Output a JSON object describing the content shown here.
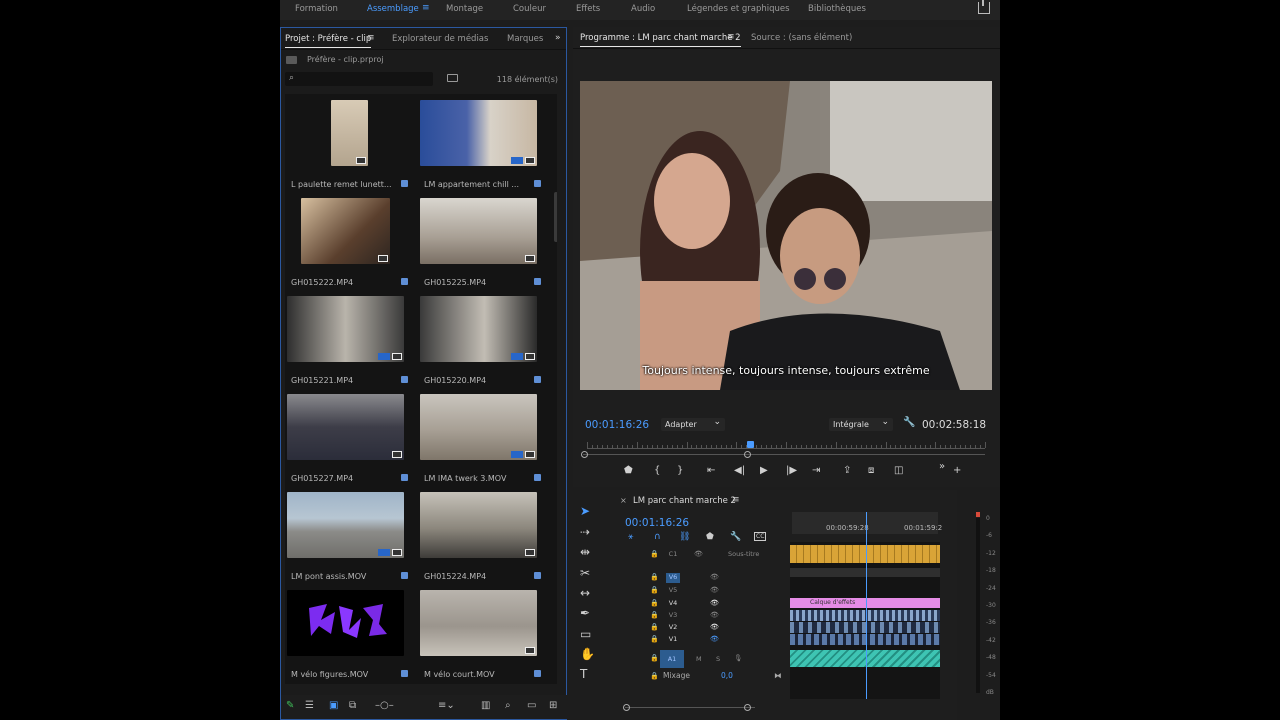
{
  "workspaces": [
    "Formation",
    "Assemblage",
    "Montage",
    "Couleur",
    "Effets",
    "Audio",
    "Légendes et graphiques",
    "Bibliothèques"
  ],
  "active_workspace": "Assemblage",
  "project_panel": {
    "tabs": [
      "Projet : Préfère - clip",
      "Explorateur de médias",
      "Marques"
    ],
    "path": "Préfère - clip.prproj",
    "item_count": "118 élément(s)",
    "items": [
      {
        "label": "L paulette remet lunett...",
        "color": "#cfc2b0"
      },
      {
        "label": "LM appartement chill ...",
        "color": "#8a7a6e"
      },
      {
        "label": "GH015222.MP4",
        "color": "#6a4e38"
      },
      {
        "label": "GH015225.MP4",
        "color": "#b7b0a6"
      },
      {
        "label": "GH015221.MP4",
        "color": "#5a5650"
      },
      {
        "label": "GH015220.MP4",
        "color": "#4e4a45"
      },
      {
        "label": "GH015227.MP4",
        "color": "#4a4a52"
      },
      {
        "label": "LM IMA twerk 3.MOV",
        "color": "#a49d93"
      },
      {
        "label": "LM pont assis.MOV",
        "color": "#8fa0b0"
      },
      {
        "label": "GH015224.MP4",
        "color": "#6f6a60"
      },
      {
        "label": "M vélo figures.MOV",
        "color": "#000000"
      },
      {
        "label": "M vélo court.MOV",
        "color": "#9f9a94"
      }
    ]
  },
  "program_monitor": {
    "tabs": [
      "Programme : LM parc chant marche 2",
      "Source : (sans élément)"
    ],
    "subtitle": "Toujours intense, toujours intense, toujours extrême",
    "current_tc": "00:01:16:26",
    "fit": "Adapter",
    "quality": "Intégrale",
    "duration_tc": "00:02:58:18",
    "playhead_fraction": 0.41
  },
  "timeline": {
    "tab": "LM parc chant marche 2",
    "current_tc": "00:01:16:26",
    "ruler_labels": [
      "00:00:59:28",
      "00:01:59:2"
    ],
    "subtitle_track": "Sous-titre",
    "effects_clip": "Calque d'effets",
    "video_tracks": [
      "V6",
      "V5",
      "V4",
      "V3",
      "V2",
      "V1"
    ],
    "audio_track": "A1",
    "mix_label": "Mixage",
    "mix_value": "0,0",
    "subtitle_track_code": "C1"
  },
  "vu_scale": [
    "0",
    "-6",
    "-12",
    "-18",
    "-24",
    "-30",
    "-36",
    "-42",
    "-48",
    "-54",
    "dB"
  ],
  "colors": {
    "accent": "#4b9cff",
    "effects_clip": "#e58ce6",
    "subtitle_clip": "#d9a437",
    "audio_clip": "#3ec4b3"
  }
}
